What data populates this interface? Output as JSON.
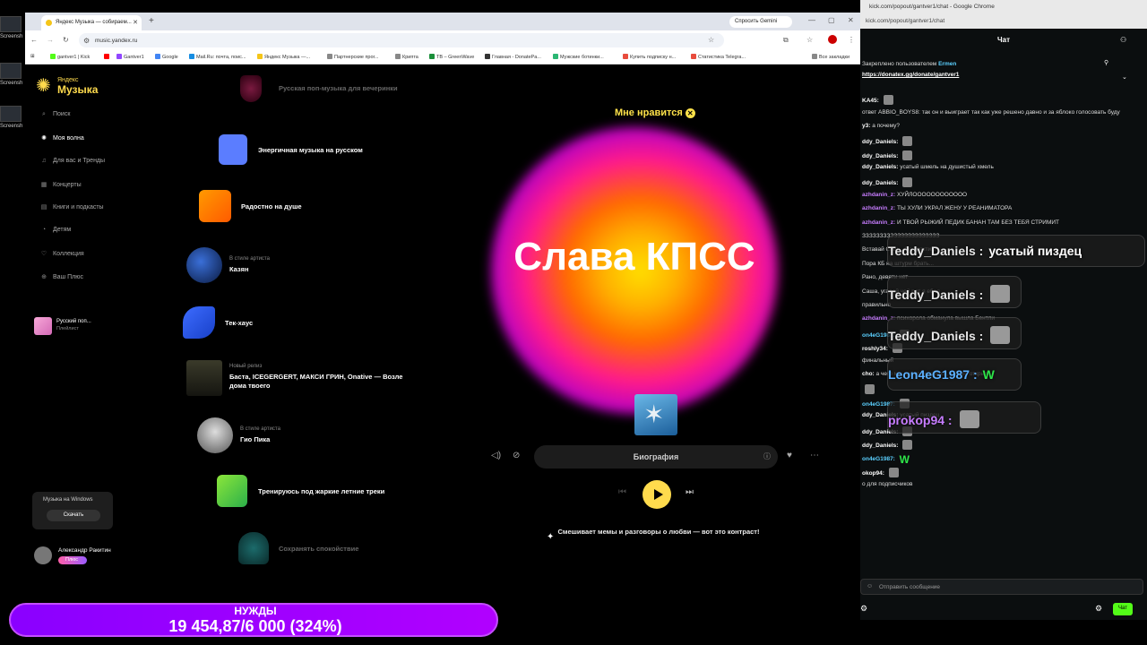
{
  "desktop": {
    "icon_label": "Screensh"
  },
  "browser": {
    "tab_title": "Яндекс Музыка — собираем...",
    "gemini_label": "Спросить Gemini",
    "url": "music.yandex.ru",
    "bookmarks": [
      "gantver1 | Kick",
      "Gantver1",
      "Google",
      "Mail.Ru: почта, поис...",
      "Яндекс Музыка —...",
      "Партнерские прог...",
      "Крипта",
      "ТВ – GreenWave",
      "Главная - DonatePa...",
      "Мужские ботинки...",
      "Купить подписку н...",
      "Статистика Telegra...",
      "Все закладки"
    ]
  },
  "ym": {
    "logo_top": "Яндекс",
    "logo_main": "Музыка",
    "sidebar": [
      {
        "label": "Поиск",
        "icon": "search-icon"
      },
      {
        "label": "Моя волна",
        "icon": "wave-icon"
      },
      {
        "label": "Для вас и Тренды",
        "icon": "note-icon"
      },
      {
        "label": "Концерты",
        "icon": "calendar-icon"
      },
      {
        "label": "Книги и подкасты",
        "icon": "book-icon"
      },
      {
        "label": "Детям",
        "icon": "bear-icon"
      },
      {
        "label": "Коллекция",
        "icon": "heart-icon"
      },
      {
        "label": "Ваш Плюс",
        "icon": "plus-icon"
      }
    ],
    "mini_playlist": {
      "title": "Русский поп...",
      "subtitle": "Плейлист"
    },
    "windows_promo": {
      "text": "Музыка на Windows",
      "button": "Скачать"
    },
    "user": {
      "name": "Александр Ракитин",
      "badge": "Плюс"
    },
    "waves": [
      {
        "title": "Русская поп-музыка для вечеринки",
        "subtitle": ""
      },
      {
        "title": "Энергичная музыка на русском",
        "subtitle": ""
      },
      {
        "title": "Радостно на душе",
        "subtitle": ""
      },
      {
        "title": "Казян",
        "subtitle": "В стиле артиста"
      },
      {
        "title": "Тек-хаус",
        "subtitle": ""
      },
      {
        "title": "Баста, ICEGERGERT, МАКСИ ГРИН, Onative — Возле дома твоего",
        "subtitle": "Новый релиз"
      },
      {
        "title": "Гио Пика",
        "subtitle": "В стиле артиста"
      },
      {
        "title": "Тренируюсь под жаркие летние треки",
        "subtitle": ""
      },
      {
        "title": "Сохранять спокойствие",
        "subtitle": ""
      }
    ],
    "likes_label": "Мне нравится",
    "artist": "Слава КПСС",
    "track": "Биография",
    "ai_description": "Смешивает мемы и разговоры о любви — вот это контраст!"
  },
  "chat": {
    "window_title": "kick.com/popout/gantver1/chat - Google Chrome",
    "url": "kick.com/popout/gantver1/chat",
    "header": "Чат",
    "pinned_by": "Закреплено пользователем",
    "pinned_user": "Ermen",
    "pinned_link": "https://donatex.gg/donate/gantver1",
    "messages": [
      {
        "user": "KA45:",
        "text": ""
      },
      {
        "user": "",
        "text": "ответ ABBIO_BOYS8: так он и выиграет так как уже решено давно и за яблоко голосовать буду"
      },
      {
        "user": "y3:",
        "text": "а почему?"
      },
      {
        "user": "ddy_Daniels:",
        "text": ""
      },
      {
        "user": "ddy_Daniels:",
        "text": ""
      },
      {
        "user": "ddy_Daniels:",
        "text": "усатый шмель на душистый хмель"
      },
      {
        "user": "ddy_Daniels:",
        "text": ""
      },
      {
        "user": "azhdanin_z:",
        "text": "ХУЙЛОООООООООООО"
      },
      {
        "user": "azhdanin_z:",
        "text": "ТЫ ХУЛИ УКРАЛ ЖЕНУ У РЕАНИМАТОРА"
      },
      {
        "user": "azhdanin_z:",
        "text": "И ТВОЙ РЫЖИЙ ПЕДИК БАНАН ТАМ БЕЗ ТЕБЯ СТРИМИТ"
      },
      {
        "user": "",
        "text": "ЗЗЗЗЗЗЗЗЗЗЗЗЗЗЗЗЗЗЗЗЗЗ"
      },
      {
        "user": "",
        "text": "Вставай Саш... Не кряхти..."
      },
      {
        "user": "",
        "text": "Пора КБ на штурм брать..."
      },
      {
        "user": "",
        "text": "Рано, девяти нет"
      },
      {
        "user": "",
        "text": "Саша, угадай чей рот я ебал"
      },
      {
        "user": "",
        "text": "правильно"
      },
      {
        "user": "azhdanin_z:",
        "text": "психорола обманула вышла Бентли"
      },
      {
        "user": "on4eG1987:",
        "text": ""
      },
      {
        "user": "roshly34:",
        "text": ""
      },
      {
        "user": "",
        "text": "финальный"
      },
      {
        "user": "cho:",
        "text": "а чего мы прохлаждаемся, кб уже открыт"
      },
      {
        "user": "",
        "text": ""
      },
      {
        "user": "on4eG1987:",
        "text": ""
      },
      {
        "user": "ddy_Daniels:",
        "text": "усатый пиздец"
      },
      {
        "user": "ddy_Daniels:",
        "text": ""
      },
      {
        "user": "ddy_Daniels:",
        "text": ""
      },
      {
        "user": "on4eG1987:",
        "text": "W"
      },
      {
        "user": "okop94:",
        "text": ""
      },
      {
        "user": "",
        "text": "о для подписчиков"
      }
    ],
    "overlays": [
      {
        "name": "Teddy_Daniels :",
        "text": "усатый пиздец"
      },
      {
        "name": "Teddy_Daniels :",
        "text": ""
      },
      {
        "name": "Teddy_Daniels :",
        "text": ""
      },
      {
        "name": "Leon4eG1987 :",
        "text": "W"
      },
      {
        "name": "prokop94 :",
        "text": ""
      }
    ],
    "input_placeholder": "Отправить сообщение",
    "send_label": "Чат"
  },
  "donation": {
    "title": "НУЖДЫ",
    "progress_text": "19 454,87/6 000 (324%)",
    "percent": 324
  }
}
